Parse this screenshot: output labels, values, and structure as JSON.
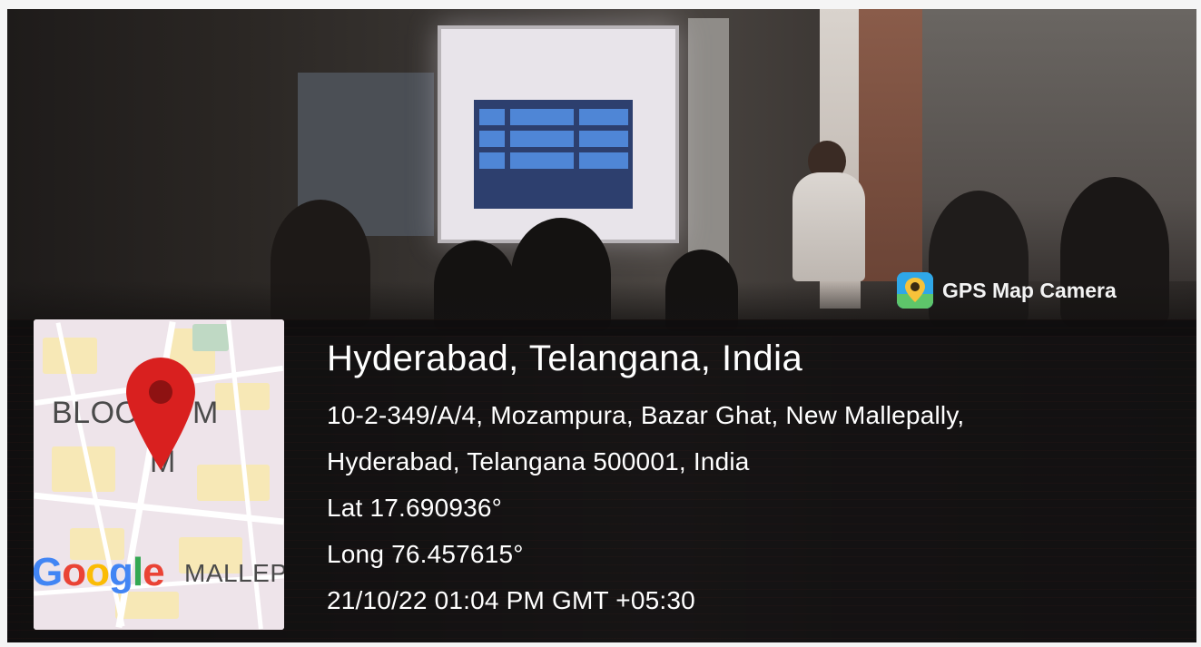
{
  "badge": {
    "label": "GPS Map Camera",
    "icon": "gps-map-camera-app-icon"
  },
  "map": {
    "labels": {
      "top": "BLOO",
      "top_right": "M",
      "below": "M",
      "bottom_right": "MALLEP"
    },
    "brand": "Google",
    "pin_color": "#d9201f"
  },
  "location": {
    "title": "Hyderabad, Telangana, India",
    "address_line1": "10-2-349/A/4, Mozampura, Bazar Ghat, New Mallepally,",
    "address_line2": "Hyderabad, Telangana 500001, India",
    "latitude": "Lat 17.690936°",
    "longitude": "Long 76.457615°",
    "datetime": "21/10/22 01:04 PM GMT +05:30"
  },
  "colors": {
    "overlay": "#0e0d0e",
    "text": "#ffffff",
    "badge_icon": "#2fa7e8"
  }
}
